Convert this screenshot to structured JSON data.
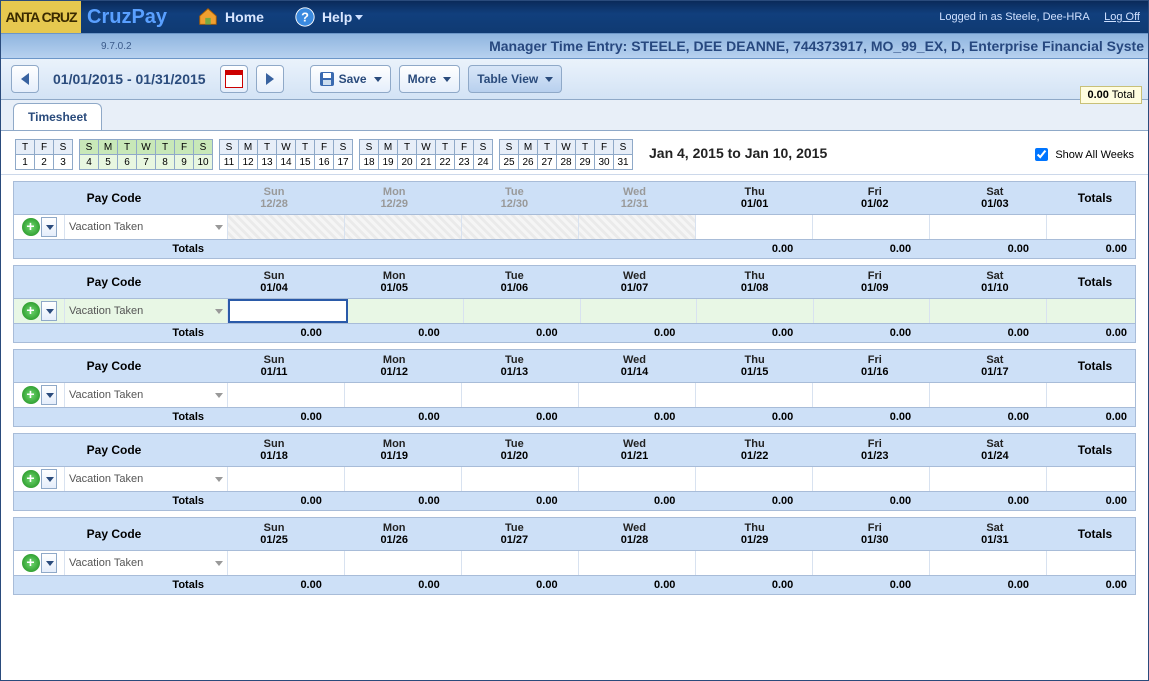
{
  "header": {
    "logo_small": "ANTA CRUZ",
    "brand": "CruzPay",
    "home": "Home",
    "help": "Help",
    "logged_in_prefix": "Logged in as ",
    "logged_in_user": "Steele, Dee-HRA",
    "log_off": "Log Off",
    "version": "9.7.0.2",
    "context": "Manager Time Entry: STEELE, DEE DEANNE, 744373917, MO_99_EX, D, Enterprise Financial Syste"
  },
  "toolbar": {
    "date_range": "01/01/2015 - 01/31/2015",
    "save": "Save",
    "more": "More",
    "table_view": "Table View"
  },
  "tabs": {
    "timesheet": "Timesheet"
  },
  "summary": {
    "total_value": "0.00",
    "total_label": " Total"
  },
  "weekstrip": {
    "range_label": "Jan 4, 2015 to Jan 10, 2015",
    "show_all": "Show All Weeks",
    "groups": [
      {
        "days": [
          "T",
          "F",
          "S"
        ],
        "nums": [
          "1",
          "2",
          "3"
        ],
        "active": false
      },
      {
        "days": [
          "S",
          "M",
          "T",
          "W",
          "T",
          "F",
          "S"
        ],
        "nums": [
          "4",
          "5",
          "6",
          "7",
          "8",
          "9",
          "10"
        ],
        "active": true
      },
      {
        "days": [
          "S",
          "M",
          "T",
          "W",
          "T",
          "F",
          "S"
        ],
        "nums": [
          "11",
          "12",
          "13",
          "14",
          "15",
          "16",
          "17"
        ],
        "active": false
      },
      {
        "days": [
          "S",
          "M",
          "T",
          "W",
          "T",
          "F",
          "S"
        ],
        "nums": [
          "18",
          "19",
          "20",
          "21",
          "22",
          "23",
          "24"
        ],
        "active": false
      },
      {
        "days": [
          "S",
          "M",
          "T",
          "W",
          "T",
          "F",
          "S"
        ],
        "nums": [
          "25",
          "26",
          "27",
          "28",
          "29",
          "30",
          "31"
        ],
        "active": false
      }
    ]
  },
  "labels": {
    "pay_code": "Pay Code",
    "totals": "Totals",
    "vacation_taken": "Vacation Taken"
  },
  "weeks": [
    {
      "headers": [
        {
          "dow": "Sun",
          "date": "12/28",
          "dim": true
        },
        {
          "dow": "Mon",
          "date": "12/29",
          "dim": true
        },
        {
          "dow": "Tue",
          "date": "12/30",
          "dim": true
        },
        {
          "dow": "Wed",
          "date": "12/31",
          "dim": true
        },
        {
          "dow": "Thu",
          "date": "01/01",
          "dim": false
        },
        {
          "dow": "Fri",
          "date": "01/02",
          "dim": false
        },
        {
          "dow": "Sat",
          "date": "01/03",
          "dim": false
        }
      ],
      "row_green": false,
      "edit_index": -1,
      "hatch_count": 4,
      "totals": [
        "",
        "",
        "",
        "",
        "0.00",
        "0.00",
        "0.00"
      ],
      "row_total": "0.00"
    },
    {
      "headers": [
        {
          "dow": "Sun",
          "date": "01/04"
        },
        {
          "dow": "Mon",
          "date": "01/05"
        },
        {
          "dow": "Tue",
          "date": "01/06"
        },
        {
          "dow": "Wed",
          "date": "01/07"
        },
        {
          "dow": "Thu",
          "date": "01/08"
        },
        {
          "dow": "Fri",
          "date": "01/09"
        },
        {
          "dow": "Sat",
          "date": "01/10"
        }
      ],
      "row_green": true,
      "edit_index": 0,
      "hatch_count": 0,
      "totals": [
        "0.00",
        "0.00",
        "0.00",
        "0.00",
        "0.00",
        "0.00",
        "0.00"
      ],
      "row_total": "0.00"
    },
    {
      "headers": [
        {
          "dow": "Sun",
          "date": "01/11"
        },
        {
          "dow": "Mon",
          "date": "01/12"
        },
        {
          "dow": "Tue",
          "date": "01/13"
        },
        {
          "dow": "Wed",
          "date": "01/14"
        },
        {
          "dow": "Thu",
          "date": "01/15"
        },
        {
          "dow": "Fri",
          "date": "01/16"
        },
        {
          "dow": "Sat",
          "date": "01/17"
        }
      ],
      "row_green": false,
      "edit_index": -1,
      "hatch_count": 0,
      "totals": [
        "0.00",
        "0.00",
        "0.00",
        "0.00",
        "0.00",
        "0.00",
        "0.00"
      ],
      "row_total": "0.00"
    },
    {
      "headers": [
        {
          "dow": "Sun",
          "date": "01/18"
        },
        {
          "dow": "Mon",
          "date": "01/19"
        },
        {
          "dow": "Tue",
          "date": "01/20"
        },
        {
          "dow": "Wed",
          "date": "01/21"
        },
        {
          "dow": "Thu",
          "date": "01/22"
        },
        {
          "dow": "Fri",
          "date": "01/23"
        },
        {
          "dow": "Sat",
          "date": "01/24"
        }
      ],
      "row_green": false,
      "edit_index": -1,
      "hatch_count": 0,
      "totals": [
        "0.00",
        "0.00",
        "0.00",
        "0.00",
        "0.00",
        "0.00",
        "0.00"
      ],
      "row_total": "0.00"
    },
    {
      "headers": [
        {
          "dow": "Sun",
          "date": "01/25"
        },
        {
          "dow": "Mon",
          "date": "01/26"
        },
        {
          "dow": "Tue",
          "date": "01/27"
        },
        {
          "dow": "Wed",
          "date": "01/28"
        },
        {
          "dow": "Thu",
          "date": "01/29"
        },
        {
          "dow": "Fri",
          "date": "01/30"
        },
        {
          "dow": "Sat",
          "date": "01/31"
        }
      ],
      "row_green": false,
      "edit_index": -1,
      "hatch_count": 0,
      "totals": [
        "0.00",
        "0.00",
        "0.00",
        "0.00",
        "0.00",
        "0.00",
        "0.00"
      ],
      "row_total": "0.00"
    }
  ]
}
